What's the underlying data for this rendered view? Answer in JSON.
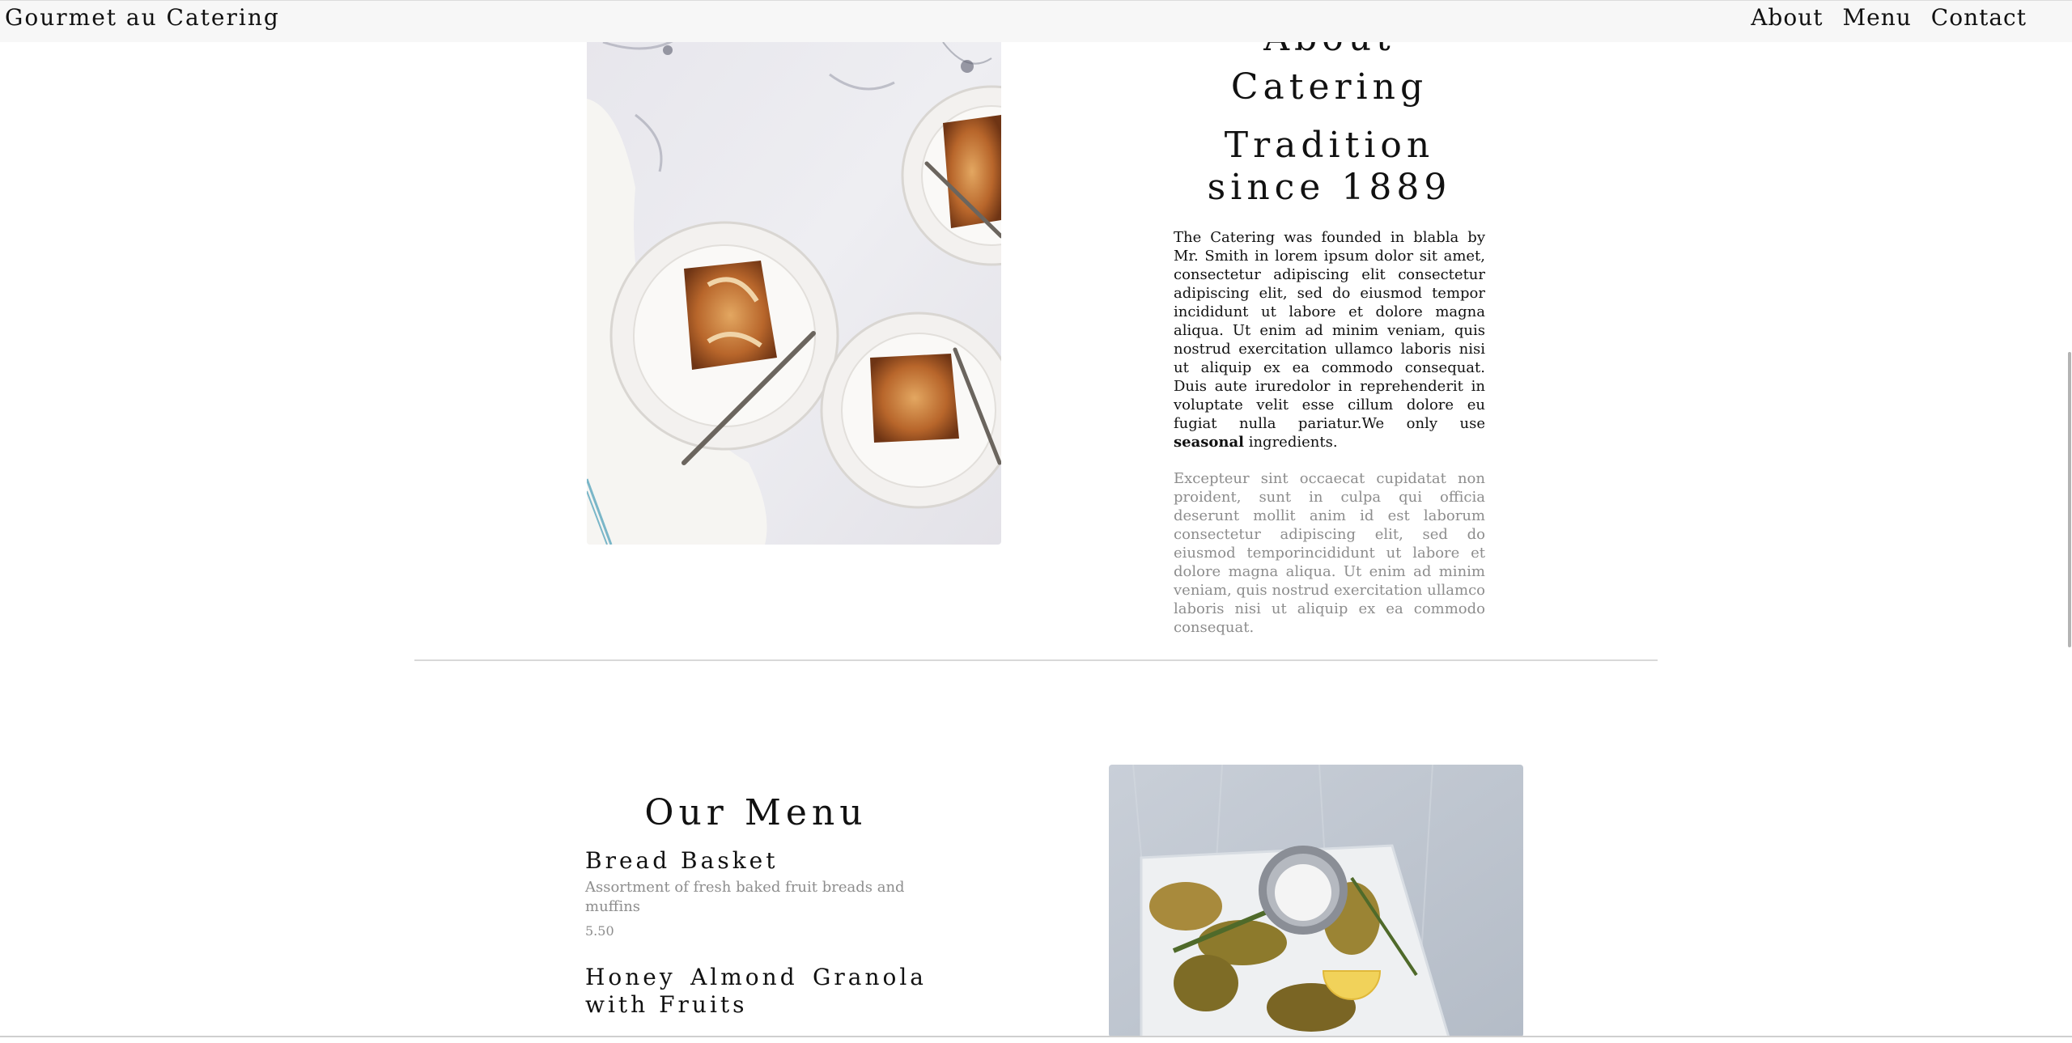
{
  "header": {
    "brand": "Gourmet au Catering",
    "nav": [
      "About",
      "Menu",
      "Contact"
    ]
  },
  "about": {
    "title": "About Catering",
    "subtitle": "Tradition since 1889",
    "paragraph_before_bold": "The Catering was founded in blabla by Mr. Smith in lorem ipsum dolor sit amet, consectetur adipiscing elit consectetur adipiscing elit, sed do eiusmod tempor incididunt ut labore et dolore magna aliqua. Ut enim ad minim veniam, quis nostrud exercitation ullamco laboris nisi ut aliquip ex ea commodo consequat. Duis aute iruredolor in reprehenderit in voluptate velit esse cillum dolore eu fugiat nulla pariatur.We only use ",
    "paragraph_bold": "seasonal",
    "paragraph_after_bold": " ingredients.",
    "paragraph_muted": "Excepteur sint occaecat cupidatat non proident, sunt in culpa qui officia deserunt mollit anim id est laborum consectetur adipiscing elit, sed do eiusmod temporincididunt ut labore et dolore magna aliqua. Ut enim ad minim veniam, quis nostrud exercitation ullamco laboris nisi ut aliquip ex ea commodo consequat."
  },
  "menu": {
    "title": "Our Menu",
    "items": [
      {
        "name": "Bread Basket",
        "description": "Assortment of fresh baked fruit breads and muffins",
        "price": "5.50"
      },
      {
        "name": "Honey Almond Granola with Fruits"
      }
    ]
  },
  "colors": {
    "topbar_bg": "#f7f7f7",
    "text": "#111111",
    "muted_text": "#8d8d8d",
    "divider": "#d8d8d8"
  }
}
